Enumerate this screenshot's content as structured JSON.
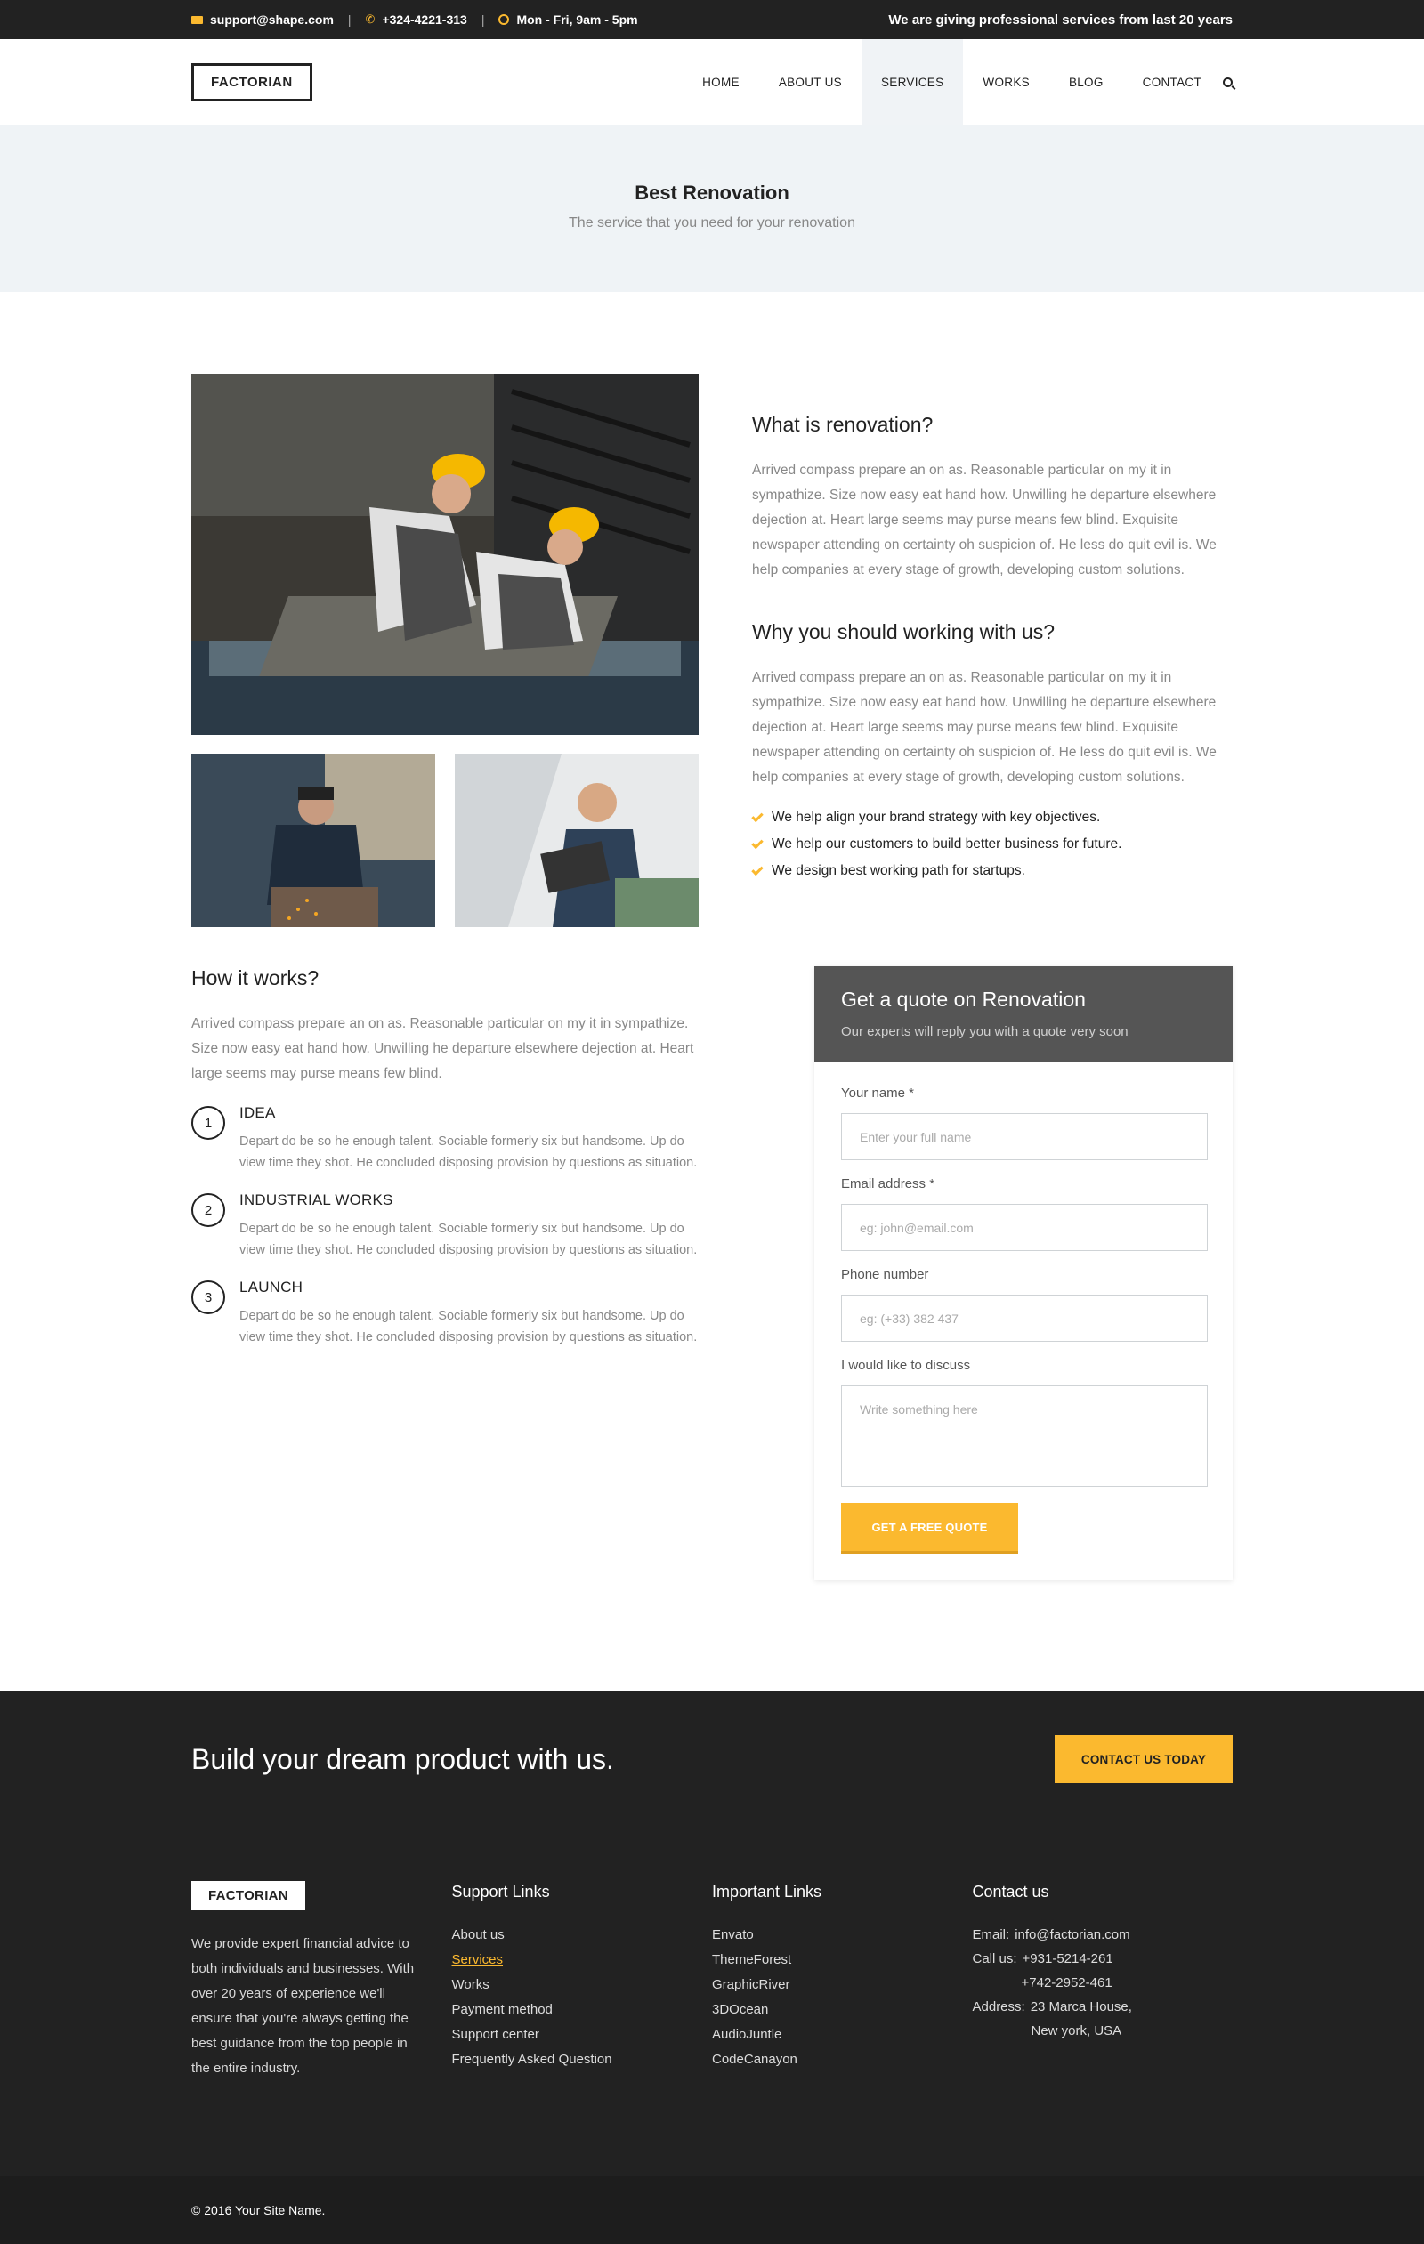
{
  "topbar": {
    "email": "support@shape.com",
    "phone": "+324-4221-313",
    "hours": "Mon - Fri, 9am - 5pm",
    "tagline": "We are giving professional services from last 20 years"
  },
  "header": {
    "logo": "FACTORIAN",
    "nav": [
      "HOME",
      "ABOUT US",
      "SERVICES",
      "WORKS",
      "BLOG",
      "CONTACT"
    ],
    "active_nav": "SERVICES"
  },
  "page_title": {
    "title": "Best Renovation",
    "subtitle": "The service that you need for your renovation"
  },
  "intro": {
    "heading1": "What is renovation?",
    "text1": "Arrived compass prepare an on as. Reasonable particular on my it in sympathize. Size now easy eat hand how. Unwilling he departure elsewhere dejection at. Heart large seems may purse means few blind. Exquisite newspaper attending on certainty oh suspicion of. He less do quit evil is. We help companies at every stage of growth, developing custom solutions.",
    "heading2": "Why you should working with us?",
    "text2": "Arrived compass prepare an on as. Reasonable particular on my it in sympathize. Size now easy eat hand how. Unwilling he departure elsewhere dejection at. Heart large seems may purse means few blind. Exquisite newspaper attending on certainty oh suspicion of. He less do quit evil is. We help companies at every stage of growth, developing custom solutions.",
    "checklist": [
      "We help align your brand strategy with key objectives.",
      "We help our customers to build better business for future.",
      "We design best working path for startups."
    ]
  },
  "how": {
    "heading": "How it works?",
    "text": "Arrived compass prepare an on as. Reasonable particular on my it in sympathize. Size now easy eat hand how. Unwilling he departure elsewhere dejection at. Heart large seems may purse means few blind.",
    "steps": [
      {
        "num": "1",
        "title": "IDEA",
        "text": "Depart do be so he enough talent. Sociable formerly six but handsome. Up do view time they shot. He concluded disposing provision by questions as situation."
      },
      {
        "num": "2",
        "title": "INDUSTRIAL WORKS",
        "text": "Depart do be so he enough talent. Sociable formerly six but handsome. Up do view time they shot. He concluded disposing provision by questions as situation."
      },
      {
        "num": "3",
        "title": "LAUNCH",
        "text": "Depart do be so he enough talent. Sociable formerly six but handsome. Up do view time they shot. He concluded disposing provision by questions as situation."
      }
    ]
  },
  "quote_form": {
    "title": "Get a quote on Renovation",
    "subtitle": "Our experts will reply you with a quote very soon",
    "name_label": "Your name *",
    "name_placeholder": "Enter your full name",
    "email_label": "Email address *",
    "email_placeholder": "eg: john@email.com",
    "phone_label": "Phone number",
    "phone_placeholder": "eg: (+33) 382 437",
    "message_label": "I would like to discuss",
    "message_placeholder": "Write something here",
    "submit": "GET A FREE QUOTE"
  },
  "cta": {
    "heading": "Build your dream product with us.",
    "button": "CONTACT US TODAY"
  },
  "footer": {
    "logo": "FACTORIAN",
    "about": "We provide expert financial advice to both individuals and businesses. With over 20 years of experience we'll ensure that you're always getting the best guidance from the top people in the entire industry.",
    "support_title": "Support Links",
    "support_links": [
      "About us",
      "Services",
      "Works",
      "Payment method",
      "Support center",
      "Frequently Asked Question"
    ],
    "important_title": "Important Links",
    "important_links": [
      "Envato",
      "ThemeForest",
      "GraphicRiver",
      "3DOcean",
      "AudioJuntle",
      "CodeCanayon"
    ],
    "contact_title": "Contact us",
    "contact_email_label": "Email:",
    "contact_email": "info@factorian.com",
    "contact_call_label": "Call us:",
    "contact_phone1": "+931-5214-261",
    "contact_phone2": "+742-2952-461",
    "contact_address_label": "Address:",
    "contact_address1": "23 Marca House,",
    "contact_address2": "New york, USA",
    "copyright": "© 2016 Your Site Name."
  },
  "colors": {
    "accent": "#fbb92f",
    "dark": "#222222",
    "form_header": "#555555",
    "page_title_bg": "#eff3f6"
  },
  "icons": [
    "mail-icon",
    "phone-icon",
    "clock-icon",
    "search-icon",
    "check-icon"
  ]
}
